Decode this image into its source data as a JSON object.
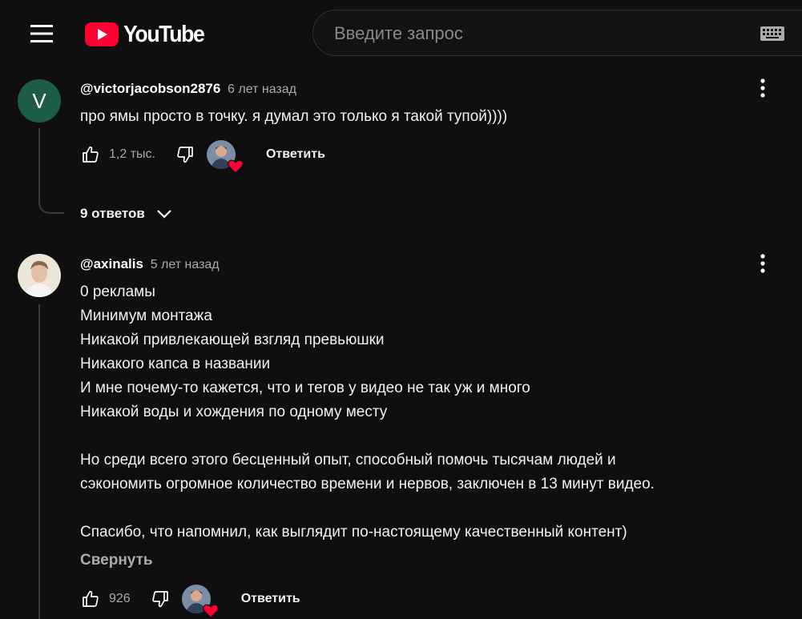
{
  "header": {
    "logo_text": "YouTube",
    "search_placeholder": "Введите запрос"
  },
  "comments": [
    {
      "avatar_letter": "V",
      "author": "@victorjacobson2876",
      "time": "6 лет назад",
      "lines": [
        "про ямы просто в точку. я думал это только я такой тупой))))"
      ],
      "likes": "1,2 тыс.",
      "reply_label": "Ответить",
      "replies_label": "9 ответов"
    },
    {
      "author": "@axinalis",
      "time": "5 лет назад",
      "lines": [
        "0 рекламы",
        "Минимум монтажа",
        "Никакой привлекающей взгляд превьюшки",
        "Никакого капса в названии",
        "И мне почему-то кажется, что и тегов у видео не так уж и много",
        "Никакой воды и хождения по одному месту",
        "",
        "Но среди всего этого бесценный опыт, способный помочь тысячам людей и",
        "сэкономить огромное количество времени и нервов, заключен в 13 минут видео.",
        "",
        "Спасибо, что напомнил, как выглядит по-настоящему качественный контент)"
      ],
      "collapse_label": "Свернуть",
      "likes": "926",
      "reply_label": "Ответить"
    }
  ],
  "colors": {
    "background": "#0f0f0f",
    "youtube_red": "#ff0033",
    "avatar_green": "#1c5c48",
    "muted_text": "#aaaaaa"
  }
}
